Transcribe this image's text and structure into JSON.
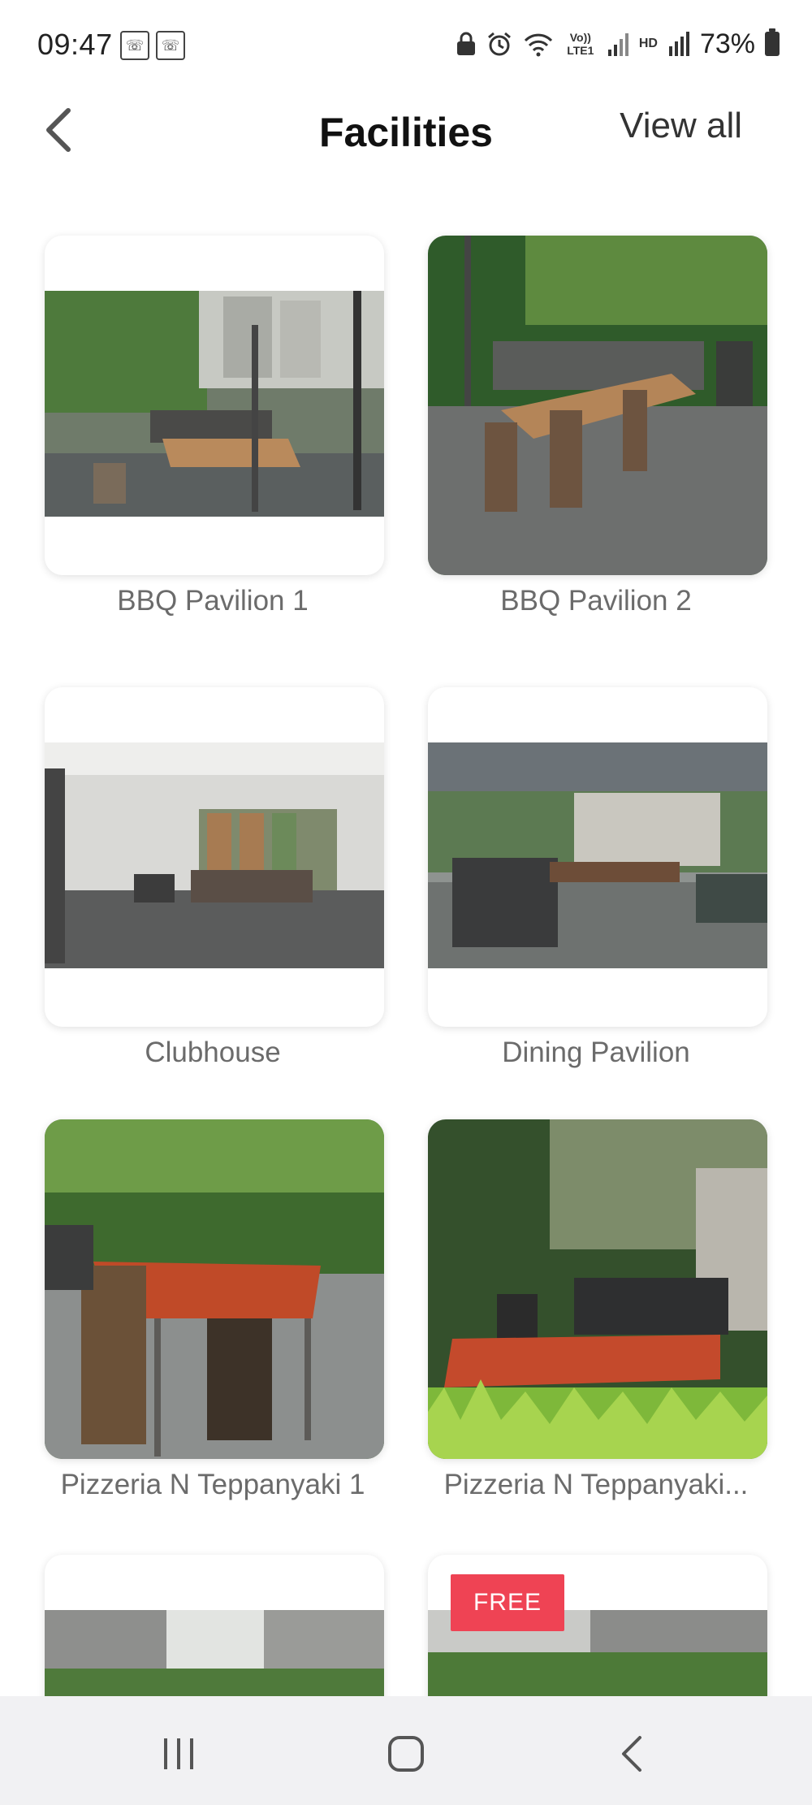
{
  "status_bar": {
    "time": "09:47",
    "notif_icons": [
      "call-icon",
      "call-icon"
    ],
    "notif_glyph": "☏",
    "icons": [
      "lock-icon",
      "alarm-icon",
      "wifi-icon",
      "volte-icon",
      "signal-icon",
      "hd-icon",
      "signal-icon"
    ],
    "volte_label": "Vo)) LTE1",
    "hd_label": "HD",
    "battery_percent": "73%"
  },
  "header": {
    "title": "Facilities",
    "back_icon": "back-arrow-icon",
    "view_all_label": "View all"
  },
  "facilities": [
    {
      "name": "BBQ Pavilion 1",
      "photo": "pavilion-photo"
    },
    {
      "name": "BBQ Pavilion 2",
      "photo": "pavilion-photo"
    },
    {
      "name": "Clubhouse",
      "photo": "clubhouse-photo"
    },
    {
      "name": "Dining Pavilion",
      "photo": "pavilion-photo"
    },
    {
      "name": "Pizzeria N Teppanyaki 1",
      "photo": "pavilion-photo"
    },
    {
      "name": "Pizzeria N Teppanyaki...",
      "photo": "pavilion-photo"
    },
    {
      "name": "",
      "photo": "condo-photo"
    },
    {
      "name": "",
      "photo": "condo-photo",
      "badge": "FREE"
    }
  ],
  "nav_bar": {
    "recent_icon": "recent-apps-icon",
    "home_icon": "home-icon",
    "back_icon": "back-icon"
  },
  "colors": {
    "badge": "#ef4354",
    "label": "#6b6b6b",
    "title": "#111111",
    "nav_bg": "#f1f1f3"
  }
}
